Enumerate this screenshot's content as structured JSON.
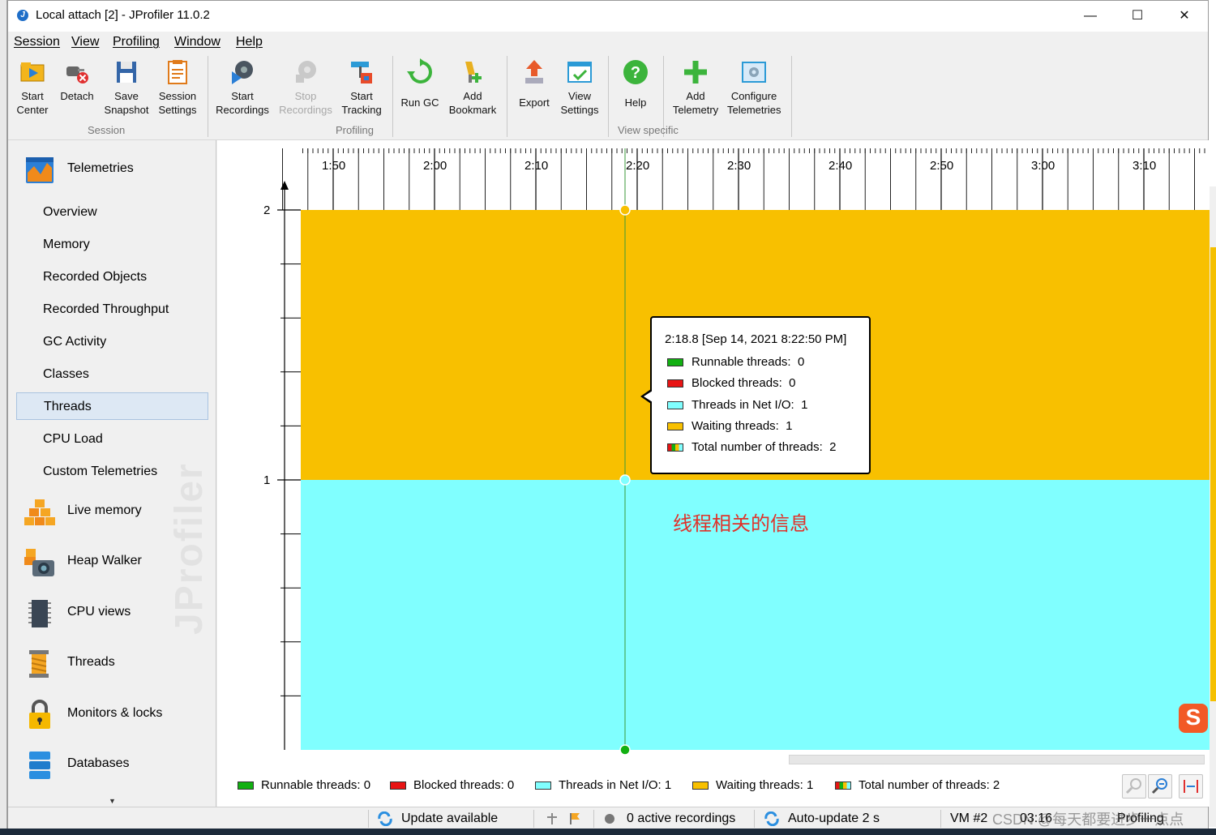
{
  "window": {
    "title": "Local attach [2] - JProfiler 11.0.2",
    "minimize": "—",
    "maximize": "☐",
    "close": "✕"
  },
  "menu": [
    "Session",
    "View",
    "Profiling",
    "Window",
    "Help"
  ],
  "toolbar": {
    "groups": {
      "session": "Session",
      "profiling": "Profiling",
      "view_specific": "View specific"
    },
    "buttons": [
      {
        "name": "start-center-button",
        "label": "Start\nCenter",
        "icon": "start-center-icon",
        "enabled": true
      },
      {
        "name": "detach-button",
        "label": "Detach",
        "icon": "detach-icon",
        "enabled": true
      },
      {
        "name": "save-snapshot-button",
        "label": "Save\nSnapshot",
        "icon": "save-icon",
        "enabled": true
      },
      {
        "name": "session-settings-button",
        "label": "Session\nSettings",
        "icon": "session-settings-icon",
        "enabled": true
      },
      {
        "name": "start-recordings-button",
        "label": "Start\nRecordings",
        "icon": "start-recordings-icon",
        "enabled": true
      },
      {
        "name": "stop-recordings-button",
        "label": "Stop\nRecordings",
        "icon": "stop-recordings-icon",
        "enabled": false
      },
      {
        "name": "start-tracking-button",
        "label": "Start\nTracking",
        "icon": "start-tracking-icon",
        "enabled": true
      },
      {
        "name": "run-gc-button",
        "label": "Run GC",
        "icon": "run-gc-icon",
        "enabled": true
      },
      {
        "name": "add-bookmark-button",
        "label": "Add\nBookmark",
        "icon": "add-bookmark-icon",
        "enabled": true
      },
      {
        "name": "export-button",
        "label": "Export",
        "icon": "export-icon",
        "enabled": true
      },
      {
        "name": "view-settings-button",
        "label": "View\nSettings",
        "icon": "view-settings-icon",
        "enabled": true
      },
      {
        "name": "help-button",
        "label": "Help",
        "icon": "help-icon",
        "enabled": true
      },
      {
        "name": "add-telemetry-button",
        "label": "Add\nTelemetry",
        "icon": "add-telemetry-icon",
        "enabled": true
      },
      {
        "name": "configure-telemetries-button",
        "label": "Configure\nTelemetries",
        "icon": "configure-telemetries-icon",
        "enabled": true
      }
    ]
  },
  "sidebar": {
    "telemetries": {
      "label": "Telemetries",
      "icon": "telemetries-icon"
    },
    "telemetry_items": [
      "Overview",
      "Memory",
      "Recorded Objects",
      "Recorded Throughput",
      "GC Activity",
      "Classes",
      "Threads",
      "CPU Load",
      "Custom Telemetries"
    ],
    "selected_item": "Threads",
    "sections": [
      {
        "label": "Live memory",
        "icon": "live-memory-icon"
      },
      {
        "label": "Heap Walker",
        "icon": "heap-walker-icon"
      },
      {
        "label": "CPU views",
        "icon": "cpu-views-icon"
      },
      {
        "label": "Threads",
        "icon": "threads-icon"
      },
      {
        "label": "Monitors & locks",
        "icon": "monitors-locks-icon"
      },
      {
        "label": "Databases",
        "icon": "databases-icon"
      }
    ],
    "watermark": "JProfiler"
  },
  "chart_data": {
    "type": "area",
    "x_ticks": [
      "1:50",
      "2:00",
      "2:10",
      "2:20",
      "2:30",
      "2:40",
      "2:50",
      "3:00",
      "3:10"
    ],
    "y_ticks": [
      "1",
      "2"
    ],
    "series": [
      {
        "name": "Threads in Net I/O",
        "color": "#80ffff",
        "value": 1
      },
      {
        "name": "Waiting threads",
        "color": "#f8c000",
        "value": 1
      }
    ],
    "cursor_time": "2:18.8"
  },
  "tooltip": {
    "title": "2:18.8 [Sep 14, 2021 8:22:50 PM]",
    "rows": [
      {
        "label": "Runnable threads:",
        "value": "0",
        "color": "#12b012"
      },
      {
        "label": "Blocked threads:",
        "value": "0",
        "color": "#e81414"
      },
      {
        "label": "Threads in Net I/O:",
        "value": "1",
        "color": "#80ffff"
      },
      {
        "label": "Waiting threads:",
        "value": "1",
        "color": "#f8c000"
      },
      {
        "label": "Total number of threads:",
        "value": "2",
        "color": "multi"
      }
    ]
  },
  "annotation": "线程相关的信息",
  "legend": [
    {
      "text": "Runnable threads: 0",
      "color": "#12b012"
    },
    {
      "text": "Blocked threads: 0",
      "color": "#e81414"
    },
    {
      "text": "Threads in Net I/O: 1",
      "color": "#80ffff"
    },
    {
      "text": "Waiting threads: 1",
      "color": "#f8c000"
    },
    {
      "text": "Total number of threads: 2",
      "color": "multi"
    }
  ],
  "statusbar": {
    "update": "Update available",
    "recordings": "0 active recordings",
    "autoupdate": "Auto-update 2 s",
    "vm": "VM #2",
    "time": "03:16",
    "mode": "Profiling"
  },
  "watermark_text": "CSDN @每天都要进步一点点"
}
